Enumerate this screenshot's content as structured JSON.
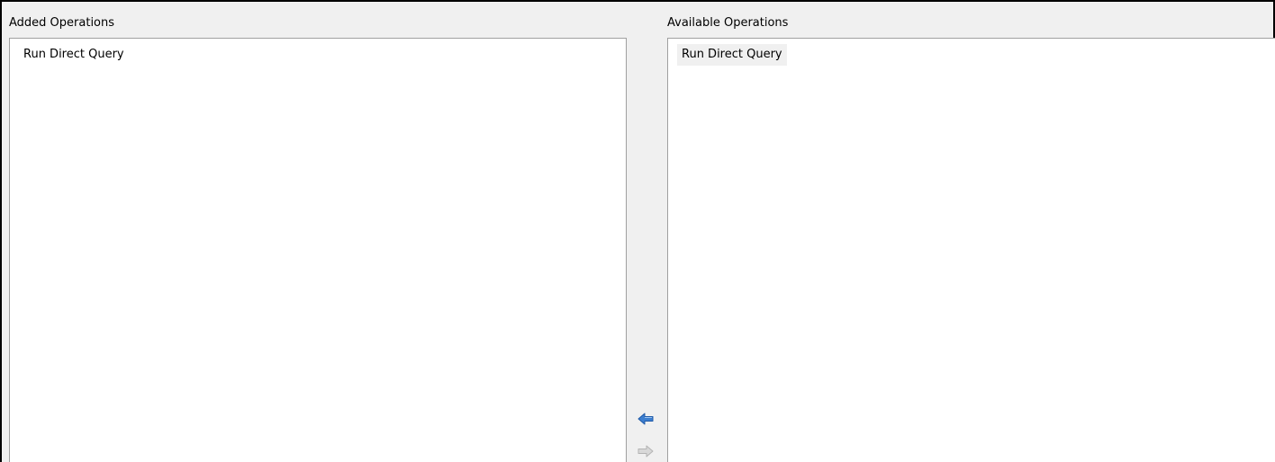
{
  "added_panel": {
    "label": "Added Operations",
    "items": [
      {
        "label": "Run Direct Query"
      }
    ]
  },
  "available_panel": {
    "label": "Available Operations",
    "items": [
      {
        "label": "Run Direct Query"
      }
    ]
  },
  "transfer": {
    "add_button_icon": "arrow-left-icon",
    "remove_button_icon": "arrow-right-icon",
    "add_button_enabled": true,
    "remove_button_enabled": false
  },
  "colors": {
    "enabled_arrow": "#3d7fd0",
    "disabled_arrow": "#c4c4c4",
    "background": "#f0f0f0",
    "list_background": "#ffffff",
    "list_border": "#a0a0a0"
  }
}
